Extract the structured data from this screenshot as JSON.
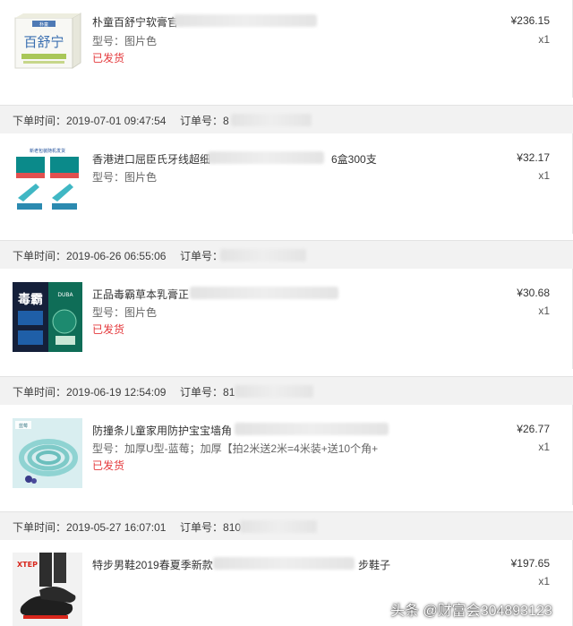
{
  "order_time_label": "下单时间：",
  "order_no_label": "订单号：",
  "spec_label": "型号：",
  "orders": [
    {
      "time": "",
      "number_prefix": "",
      "product": {
        "title": "朴童百舒宁软膏官",
        "spec": "图片色",
        "status": "已发货",
        "price": "¥236.15",
        "qty": "x1",
        "image_brand": "百舒宁"
      }
    },
    {
      "time": "2019-07-01 09:47:54",
      "number_prefix": "8",
      "product": {
        "title": "香港进口屈臣氏牙线超细",
        "title_tail": "6盒300支",
        "spec": "图片色",
        "status": "",
        "price": "¥32.17",
        "qty": "x1",
        "image_brand": "新老包装随机发货"
      }
    },
    {
      "time": "2019-06-26 06:55:06",
      "number_prefix": "",
      "product": {
        "title": "正品毒霸草本乳膏正",
        "spec": "图片色",
        "status": "已发货",
        "price": "¥30.68",
        "qty": "x1",
        "image_brand": "毒霸"
      }
    },
    {
      "time": "2019-06-19 12:54:09",
      "number_prefix": "81",
      "product": {
        "title": "防撞条儿童家用防护宝宝墙角",
        "spec": "加厚U型-蓝莓；加厚【拍2米送2米=4米装+送10个角+",
        "status": "已发货",
        "price": "¥26.77",
        "qty": "x1",
        "image_brand": "蓝莓"
      }
    },
    {
      "time": "2019-05-27 16:07:01",
      "number_prefix": "810",
      "product": {
        "title": "特步男鞋2019春夏季新款",
        "title_tail": "步鞋子",
        "spec": "",
        "status": "",
        "price": "¥197.65",
        "qty": "x1",
        "image_brand": "XTEP"
      }
    }
  ],
  "watermark": "头条 @财富会304893123"
}
